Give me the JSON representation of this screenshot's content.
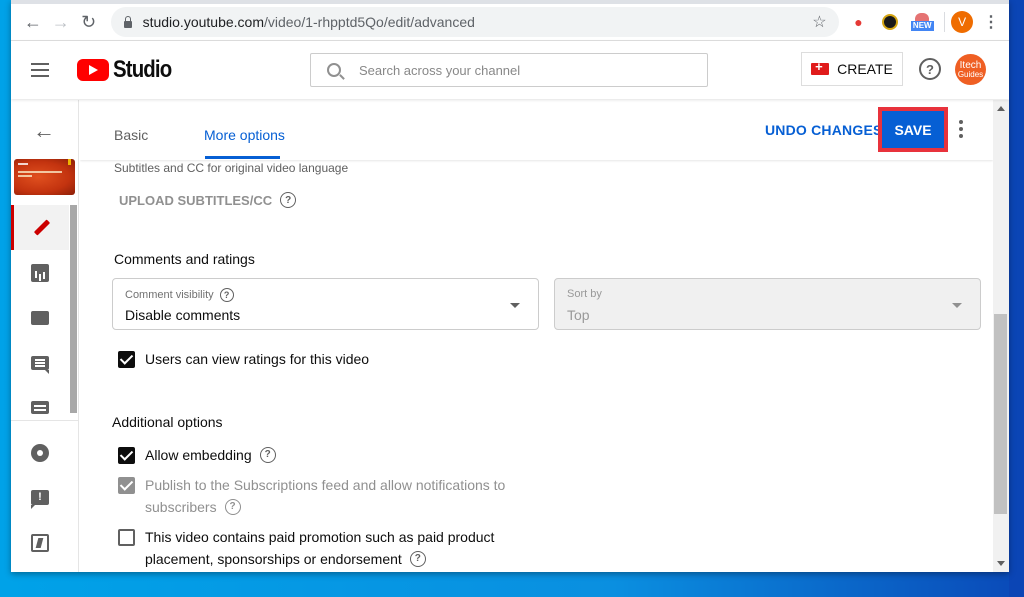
{
  "browser": {
    "url_host": "studio.youtube.com",
    "url_path": "/video/1-rhpptd5Qo/edit/advanced",
    "extensions": [
      {
        "name": "red-extension-icon"
      },
      {
        "name": "ball-extension-icon"
      },
      {
        "name": "new-extension-icon",
        "badge": "NEW"
      }
    ],
    "profile_initial": "V"
  },
  "header": {
    "logo_text": "Studio",
    "search_placeholder": "Search across your channel",
    "create_label": "CREATE",
    "help_glyph": "?",
    "channel_avatar_line1": "Itech",
    "channel_avatar_line2": "Guides"
  },
  "leftnav": {
    "back_glyph": "←",
    "items": [
      {
        "name": "details",
        "active": true
      },
      {
        "name": "analytics",
        "active": false
      },
      {
        "name": "editor",
        "active": false
      },
      {
        "name": "comments",
        "active": false
      },
      {
        "name": "subtitles",
        "active": false
      },
      {
        "name": "settings",
        "active": false
      },
      {
        "name": "send-feedback",
        "active": false
      },
      {
        "name": "return-to-classic",
        "active": false
      }
    ]
  },
  "tabs": {
    "basic": "Basic",
    "more_options": "More options",
    "active": "More options"
  },
  "actions": {
    "undo_label": "UNDO CHANGES",
    "save_label": "SAVE"
  },
  "subtitles": {
    "description": "Subtitles and CC for original video language",
    "upload_label": "UPLOAD SUBTITLES/CC"
  },
  "comments_ratings": {
    "title": "Comments and ratings",
    "comment_visibility": {
      "label": "Comment visibility",
      "value": "Disable comments"
    },
    "sort_by": {
      "label": "Sort by",
      "value": "Top",
      "disabled": true
    },
    "ratings_checkbox": {
      "label": "Users can view ratings for this video",
      "checked": true
    }
  },
  "additional_options": {
    "title": "Additional options",
    "allow_embedding": {
      "label": "Allow embedding",
      "checked": true
    },
    "publish_feed": {
      "label_line1": "Publish to the Subscriptions feed and allow notifications to",
      "label_line2": "subscribers",
      "checked": true,
      "disabled": true
    },
    "paid_promotion": {
      "label_line1": "This video contains paid promotion such as paid product",
      "label_line2": "placement, sponsorships or endorsement",
      "checked": false
    }
  },
  "help_glyph": "?"
}
